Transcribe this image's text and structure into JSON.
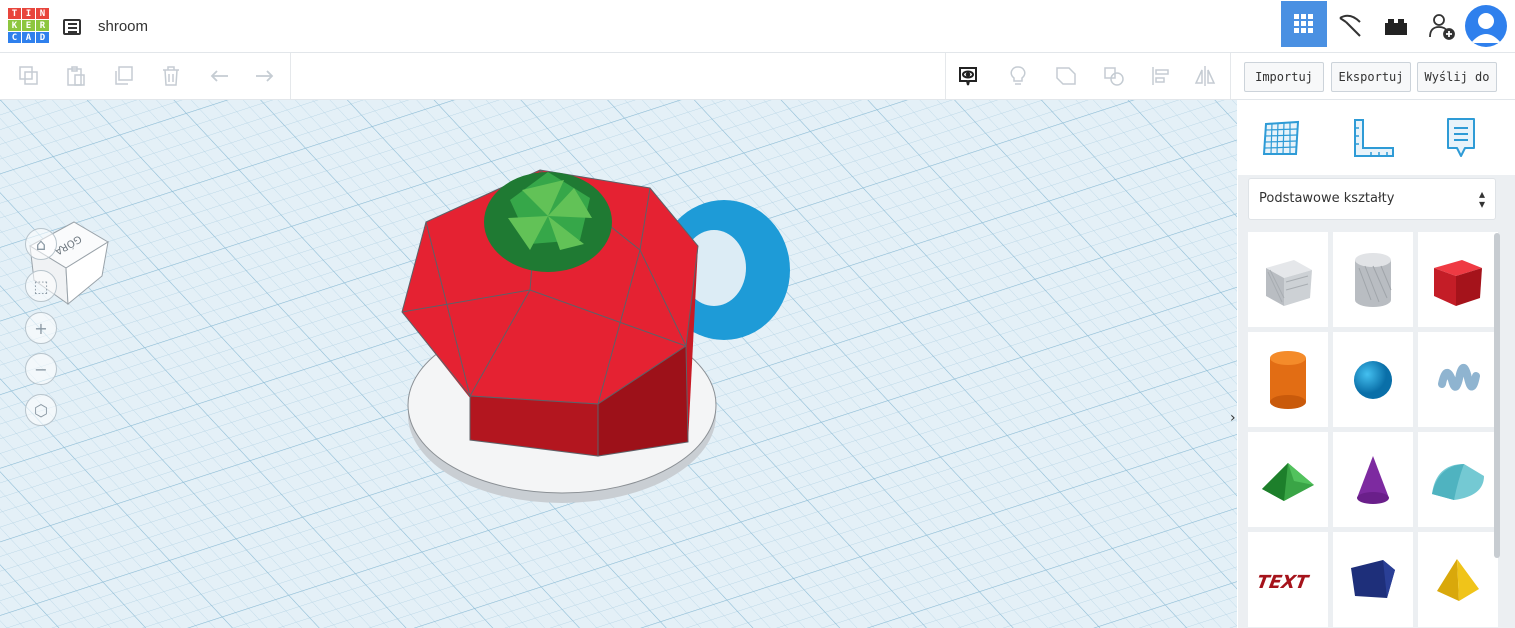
{
  "app": {
    "logo_letters": [
      "T",
      "I",
      "N",
      "K",
      "E",
      "R",
      "C",
      "A",
      "D"
    ],
    "logo_colors": [
      "#e8453c",
      "#e8453c",
      "#e8453c",
      "#8dc63f",
      "#8dc63f",
      "#8dc63f",
      "#2f80ed",
      "#2f80ed",
      "#2f80ed"
    ],
    "project_title": "shroom"
  },
  "header": {
    "icons": [
      "grid-view-icon",
      "pickaxe-icon",
      "brick-icon",
      "add-user-icon",
      "avatar-icon"
    ]
  },
  "toolbar": {
    "edit_icons": [
      "copy-icon",
      "paste-icon",
      "duplicate-icon",
      "trash-icon",
      "undo-icon",
      "redo-icon"
    ],
    "view_icons": [
      "notes-visibility-icon",
      "light-bulb-icon",
      "group-icon",
      "ungroup-icon",
      "align-icon",
      "mirror-icon"
    ],
    "import_label": "Importuj",
    "export_label": "Eksportuj",
    "send_label": "Wyślij do"
  },
  "viewcube": {
    "face_label": "GÓRA"
  },
  "sidebar": {
    "tools": [
      "workplane-icon",
      "ruler-icon",
      "notes-icon"
    ],
    "category_select": "Podstawowe kształty",
    "shapes": [
      "box",
      "cylinder-hole",
      "box-red",
      "cylinder",
      "sphere",
      "scribble",
      "roof",
      "cone",
      "round-roof",
      "text",
      "wedge",
      "pyramid"
    ],
    "text_shape_label": "TEXT"
  },
  "colors": {
    "accent": "#4a90e2",
    "grid_bg": "#dcecf5"
  }
}
